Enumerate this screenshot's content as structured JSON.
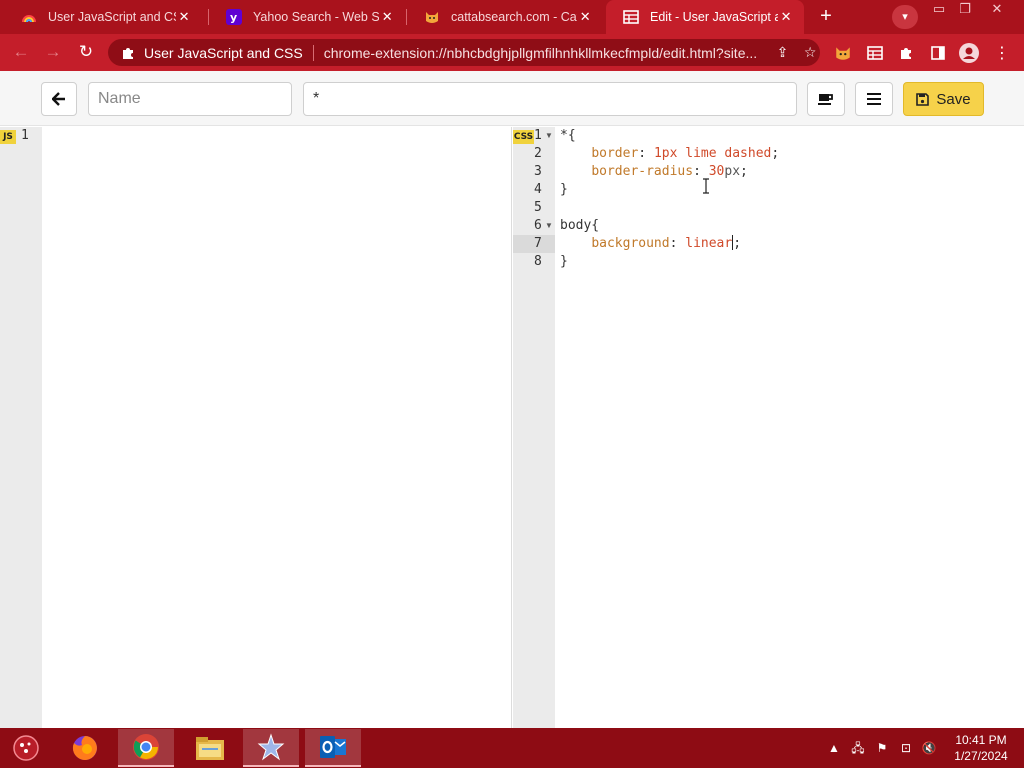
{
  "browser": {
    "tabs": [
      {
        "title": "User JavaScript and CSS",
        "favicon": "rainbow-icon",
        "active": false
      },
      {
        "title": "Yahoo Search - Web Search",
        "favicon": "yahoo-icon",
        "active": false
      },
      {
        "title": "cattabsearch.com - Cattab",
        "favicon": "cat-icon",
        "active": false
      },
      {
        "title": "Edit - User JavaScript and CSS",
        "favicon": "grid-icon",
        "active": true
      }
    ],
    "new_tab_symbol": "+",
    "omnibox": {
      "site_name": "User JavaScript and CSS",
      "url": "chrome-extension://nbhcbdghjpllgmfilhnhkllmkecfmpld/edit.html?site..."
    }
  },
  "editor": {
    "name_placeholder": "Name",
    "name_value": "",
    "url_pattern": "*",
    "save_label": "Save",
    "js_badge": "JS",
    "css_badge": "CSS",
    "js_lines": [
      "1"
    ],
    "css_line_numbers": [
      "1",
      "2",
      "3",
      "4",
      "5",
      "6",
      "7",
      "8"
    ],
    "css_code": {
      "l1": "*{",
      "l2_prop": "border",
      "l2_val1": "1px",
      "l2_val2": "lime dashed",
      "l3_prop": "border-radius",
      "l3_num": "30",
      "l3_unit": "px",
      "l4": "}",
      "l6": "body{",
      "l7_prop": "background",
      "l7_val": "linear",
      "l8": "}"
    }
  },
  "taskbar": {
    "time": "10:41 PM",
    "date": "1/27/2024"
  },
  "colors": {
    "browser_frame": "#a9121c",
    "active_tab": "#c41e2a",
    "save_button": "#f6d24a",
    "taskbar": "#8e0c14"
  }
}
